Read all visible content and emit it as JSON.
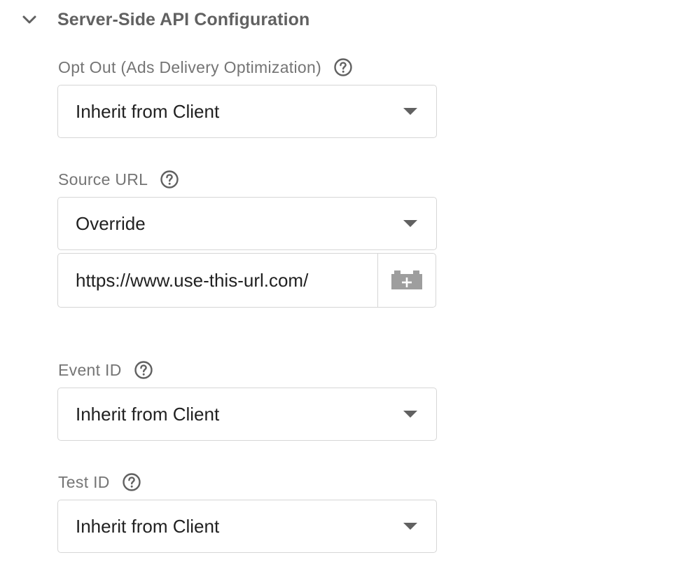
{
  "section": {
    "title": "Server-Side API Configuration",
    "expanded": true,
    "chevron_icon": "chevron-down-icon"
  },
  "fields": {
    "opt_out": {
      "label": "Opt Out (Ads Delivery Optimization)",
      "value": "Inherit from Client"
    },
    "source_url": {
      "label": "Source URL",
      "value": "Override",
      "url_value": "https://www.use-this-url.com/",
      "variable_icon": "add-variable-icon"
    },
    "event_id": {
      "label": "Event ID",
      "value": "Inherit from Client"
    },
    "test_id": {
      "label": "Test ID",
      "value": "Inherit from Client"
    }
  },
  "colors": {
    "label": "#757575",
    "title": "#616161",
    "border": "#d6d6d6",
    "text": "#212121",
    "icon": "#9e9e9e"
  }
}
